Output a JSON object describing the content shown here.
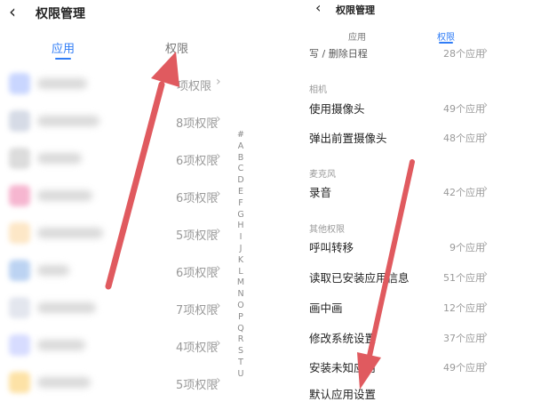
{
  "left": {
    "back_icon": "‹",
    "title": "权限管理",
    "tabs": [
      {
        "label": "应用",
        "active": true
      },
      {
        "label": "权限",
        "active": false
      }
    ],
    "rows": [
      {
        "perm": "项权限"
      },
      {
        "perm": "8项权限"
      },
      {
        "perm": "6项权限"
      },
      {
        "perm": "6项权限"
      },
      {
        "perm": "5项权限"
      },
      {
        "perm": "6项权限"
      },
      {
        "perm": "7项权限"
      },
      {
        "perm": "4项权限"
      },
      {
        "perm": "5项权限"
      }
    ],
    "index_letters": [
      "#",
      "A",
      "B",
      "C",
      "D",
      "E",
      "F",
      "G",
      "H",
      "I",
      "J",
      "K",
      "L",
      "M",
      "N",
      "O",
      "P",
      "Q",
      "R",
      "S",
      "T",
      "U"
    ]
  },
  "right": {
    "back_icon": "‹",
    "title": "权限管理",
    "tabs": [
      {
        "label": "应用",
        "active": false
      },
      {
        "label": "权限",
        "active": true
      }
    ],
    "top_partial": {
      "label": "写 / 删除日程",
      "count": "28个应用"
    },
    "sections": {
      "camera": "相机",
      "microphone": "麦克风",
      "other": "其他权限"
    },
    "camera_items": [
      {
        "label": "使用摄像头",
        "count": "49个应用"
      },
      {
        "label": "弹出前置摄像头",
        "count": "48个应用"
      }
    ],
    "microphone_items": [
      {
        "label": "录音",
        "count": "42个应用"
      }
    ],
    "other_items": [
      {
        "label": "呼叫转移",
        "count": "9个应用"
      },
      {
        "label": "读取已安装应用信息",
        "count": "51个应用"
      },
      {
        "label": "画中画",
        "count": "12个应用"
      },
      {
        "label": "修改系统设置",
        "count": "37个应用"
      },
      {
        "label": "安装未知应用",
        "count": "49个应用"
      },
      {
        "label": "默认应用设置",
        "count": ""
      }
    ]
  },
  "colors": {
    "accent": "#2f7cf6",
    "arrow": "#e05a5f"
  }
}
